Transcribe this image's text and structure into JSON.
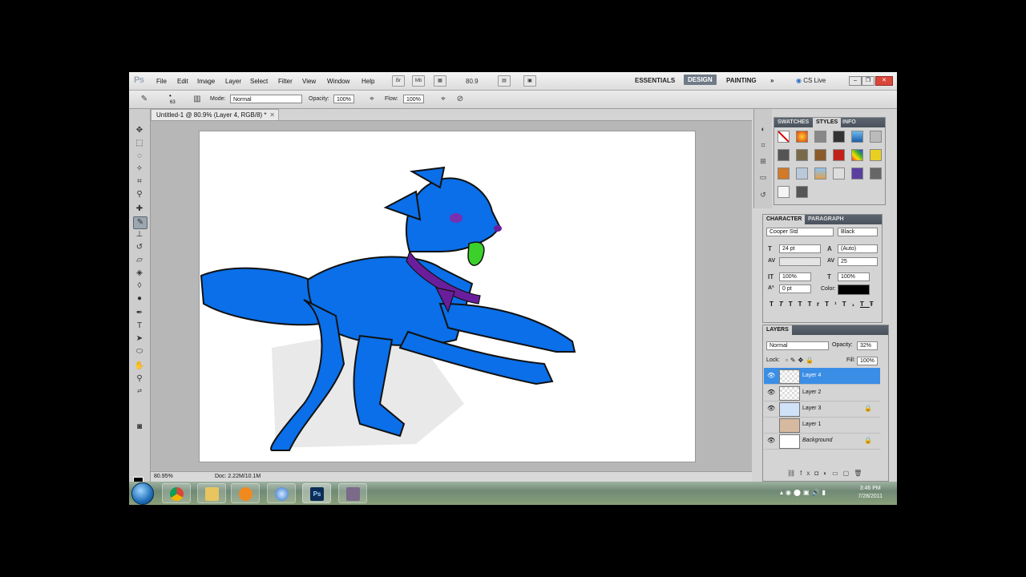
{
  "app": {
    "logo": "Ps"
  },
  "menu": [
    "File",
    "Edit",
    "Image",
    "Layer",
    "Select",
    "Filter",
    "View",
    "Window",
    "Help"
  ],
  "menubar": {
    "bridge": "Br",
    "minibridge": "Mb",
    "zoom": "80.9"
  },
  "workspaces": {
    "essentials": "ESSENTIALS",
    "design": "DESIGN",
    "painting": "PAINTING",
    "more": "»"
  },
  "cslive": "CS Live",
  "options": {
    "brush_size": "63",
    "mode_label": "Mode:",
    "mode_value": "Normal",
    "opacity_label": "Opacity:",
    "opacity_value": "100%",
    "flow_label": "Flow:",
    "flow_value": "100%"
  },
  "document": {
    "tab_title": "Untitled-1 @ 80.9% (Layer 4, RGB/8) *",
    "zoom": "80.95%",
    "doc_info": "Doc: 2.22M/10.1M"
  },
  "swatches_panel": {
    "tabs": [
      "SWATCHES",
      "STYLES",
      "INFO"
    ],
    "active": "STYLES"
  },
  "character": {
    "tabs": [
      "CHARACTER",
      "PARAGRAPH"
    ],
    "font_family": "Cooper Std",
    "font_style": "Black",
    "size": "24 pt",
    "leading": "(Auto)",
    "kerning": "",
    "tracking": "25",
    "vscale": "100%",
    "hscale": "100%",
    "baseline": "0 pt",
    "color_label": "Color:",
    "style_buttons": [
      "T",
      "T",
      "TT",
      "Tr",
      "T¹",
      "T₁",
      "T",
      "Ŧ"
    ]
  },
  "layers": {
    "title": "LAYERS",
    "blend_mode": "Normal",
    "opacity_label": "Opacity:",
    "opacity_value": "32%",
    "lock_label": "Lock:",
    "fill_label": "Fill:",
    "fill_value": "100%",
    "rows": [
      {
        "name": "Layer 4",
        "selected": true,
        "locked": false
      },
      {
        "name": "Layer 2",
        "selected": false,
        "locked": false
      },
      {
        "name": "Layer 3",
        "selected": false,
        "locked": true
      },
      {
        "name": "Layer 1",
        "selected": false,
        "locked": false
      },
      {
        "name": "Background",
        "selected": false,
        "locked": true
      }
    ]
  },
  "taskbar": {
    "time": "3:46 PM",
    "date": "7/28/2011"
  },
  "colors": {
    "accent": "#3a8ee6",
    "wolf_blue": "#0a6fe8",
    "collar": "#6a1e9c",
    "tongue": "#3bd12a"
  }
}
